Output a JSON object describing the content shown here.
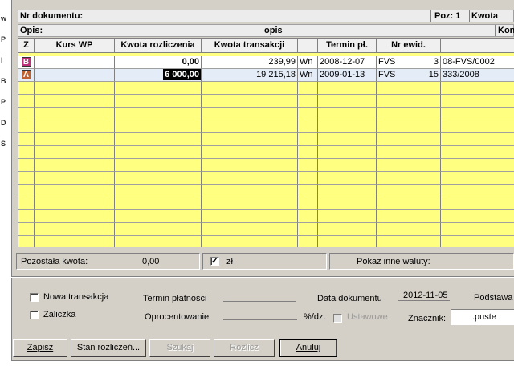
{
  "left_strip": [
    "w",
    "P",
    "I",
    "B",
    "P",
    "D",
    "S"
  ],
  "header": {
    "nr_dokumentu_label": "Nr dokumentu:",
    "poz_label": "Poz: 1",
    "kwota_label": "Kwota",
    "opis_label": "Opis:",
    "opis_value": "opis",
    "kont_label": "Kont"
  },
  "table": {
    "columns": [
      "Z",
      "Kurs WP",
      "Kwota rozliczenia",
      "Kwota transakcji",
      "",
      "Termin pł.",
      "Nr ewid.",
      "",
      ""
    ],
    "rows": [
      {
        "badge": "B",
        "badge_color": "#c0307a",
        "kurs": "",
        "kwota_rozliczenia": "0,00",
        "kwota_transakcji": "239,99",
        "strona": "Wn",
        "termin": "2008-12-07",
        "typ": "FVS",
        "nr": "3",
        "numer_dok": "08-FVS/0002"
      },
      {
        "badge": "A",
        "badge_color": "#c06030",
        "kurs": "",
        "kwota_rozliczenia": "6 000,00",
        "kwota_transakcji": "19 215,18",
        "strona": "Wn",
        "termin": "2009-01-13",
        "typ": "FVS",
        "nr": "15",
        "numer_dok": "333/2008"
      }
    ]
  },
  "status": {
    "pozostala_label": "Pozostała kwota:",
    "pozostala_value": "0,00",
    "waluta": "zł",
    "inne_waluty_label": "Pokaż inne waluty:"
  },
  "form": {
    "nowa_transakcja": "Nowa transakcja",
    "zaliczka": "Zaliczka",
    "termin_platnosci": "Termin płatności",
    "oprocentowanie": "Oprocentowanie",
    "percent_unit": "%/dz.",
    "ustawowe": "Ustawowe",
    "data_dokumentu": "Data dokumentu",
    "data_value": "2012-11-05",
    "podstawa": "Podstawa",
    "znacznik": "Znacznik:",
    "znacznik_value": ".puste"
  },
  "buttons": {
    "zapisz": "Zapisz",
    "stan": "Stan rozliczeń...",
    "szukaj": "Szukaj",
    "rozlicz": "Rozlicz",
    "anuluj": "Anuluj"
  }
}
